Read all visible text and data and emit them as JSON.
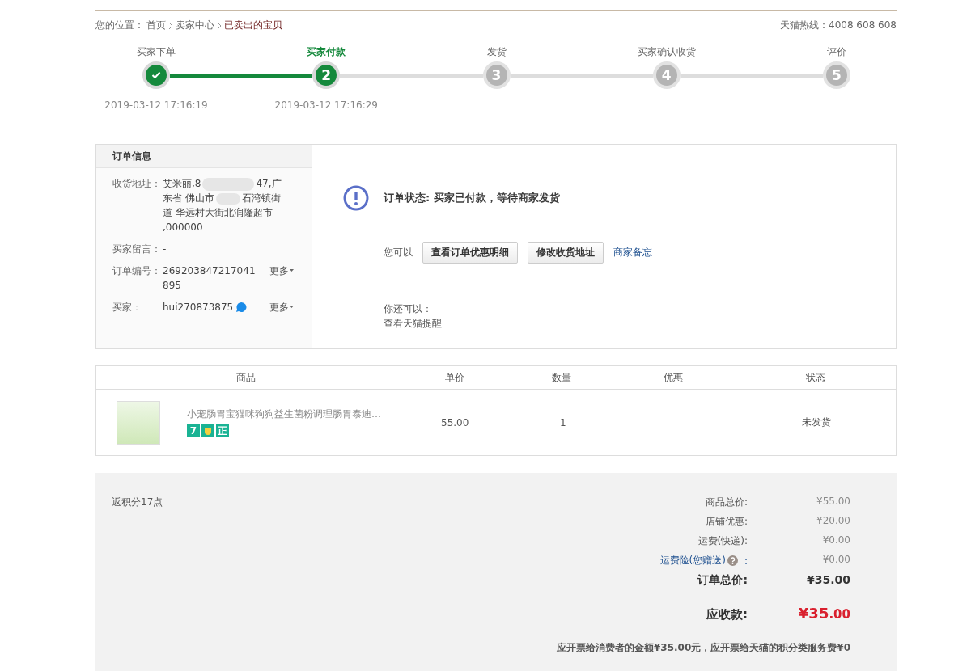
{
  "breadcrumb": {
    "prefix": "您的位置：",
    "items": [
      {
        "label": "首页",
        "current": false
      },
      {
        "label": "卖家中心",
        "current": false
      },
      {
        "label": "已卖出的宝贝",
        "current": true
      }
    ]
  },
  "hotline": "天猫热线：4008 608 608",
  "steps": [
    {
      "label": "买家下单",
      "done": true,
      "current": false,
      "time": "2019-03-12 17:16:19"
    },
    {
      "label": "买家付款",
      "number": "2",
      "done": false,
      "current": true,
      "time": "2019-03-12 17:16:29"
    },
    {
      "label": "发货",
      "number": "3",
      "done": false,
      "current": false
    },
    {
      "label": "买家确认收货",
      "number": "4",
      "done": false,
      "current": false
    },
    {
      "label": "评价",
      "number": "5",
      "done": false,
      "current": false
    }
  ],
  "order_info": {
    "title": "订单信息",
    "address_label": "收货地址：",
    "address_parts": [
      "艾米丽,8",
      "47,广东省 佛山市",
      "石湾镇街道 华远村大街北润隆超市 ,000000"
    ],
    "message_label": "买家留言：",
    "message": "-",
    "order_no_label": "订单编号：",
    "order_no": "269203847217041895",
    "more": "更多",
    "buyer_label": "买家：",
    "buyer": "hui270873875",
    "buyer_more": "更多"
  },
  "status": {
    "text": "订单状态: 买家已付款，等待商家发货",
    "actions_label": "您可以",
    "buttons": [
      "查看订单优惠明细",
      "修改收货地址"
    ],
    "link": "商家备忘",
    "extra_label": "你还可以：",
    "extra_link": "查看天猫提醒"
  },
  "table": {
    "columns": [
      "商品",
      "单价",
      "数量",
      "优惠",
      "状态"
    ],
    "rows": [
      {
        "name": "小宠肠胃宝猫咪狗狗益生菌粉调理肠胃泰迪…",
        "tags": [
          "7",
          "正"
        ],
        "price": "55.00",
        "qty": "1",
        "state": "未发货"
      }
    ]
  },
  "summary": {
    "points": "返积分17点",
    "lines": [
      {
        "label": "商品总价:",
        "value": "¥55.00",
        "kind": "plain"
      },
      {
        "label": "店铺优惠:",
        "value": "-¥20.00",
        "kind": "plain"
      },
      {
        "label": "运费(快递):",
        "value": "¥0.00",
        "kind": "plain"
      },
      {
        "label": "运费险(您赠送)",
        "suffix": ":",
        "value": "¥0.00",
        "kind": "link"
      },
      {
        "label": "订单总价:",
        "value": "¥35.00",
        "kind": "total"
      }
    ],
    "due_label": "应收款:",
    "due_main": "¥35",
    "due_cents": ".00",
    "invoice": "应开票给消费者的金额¥35.00元，应开票给天猫的积分类服务费¥0"
  }
}
